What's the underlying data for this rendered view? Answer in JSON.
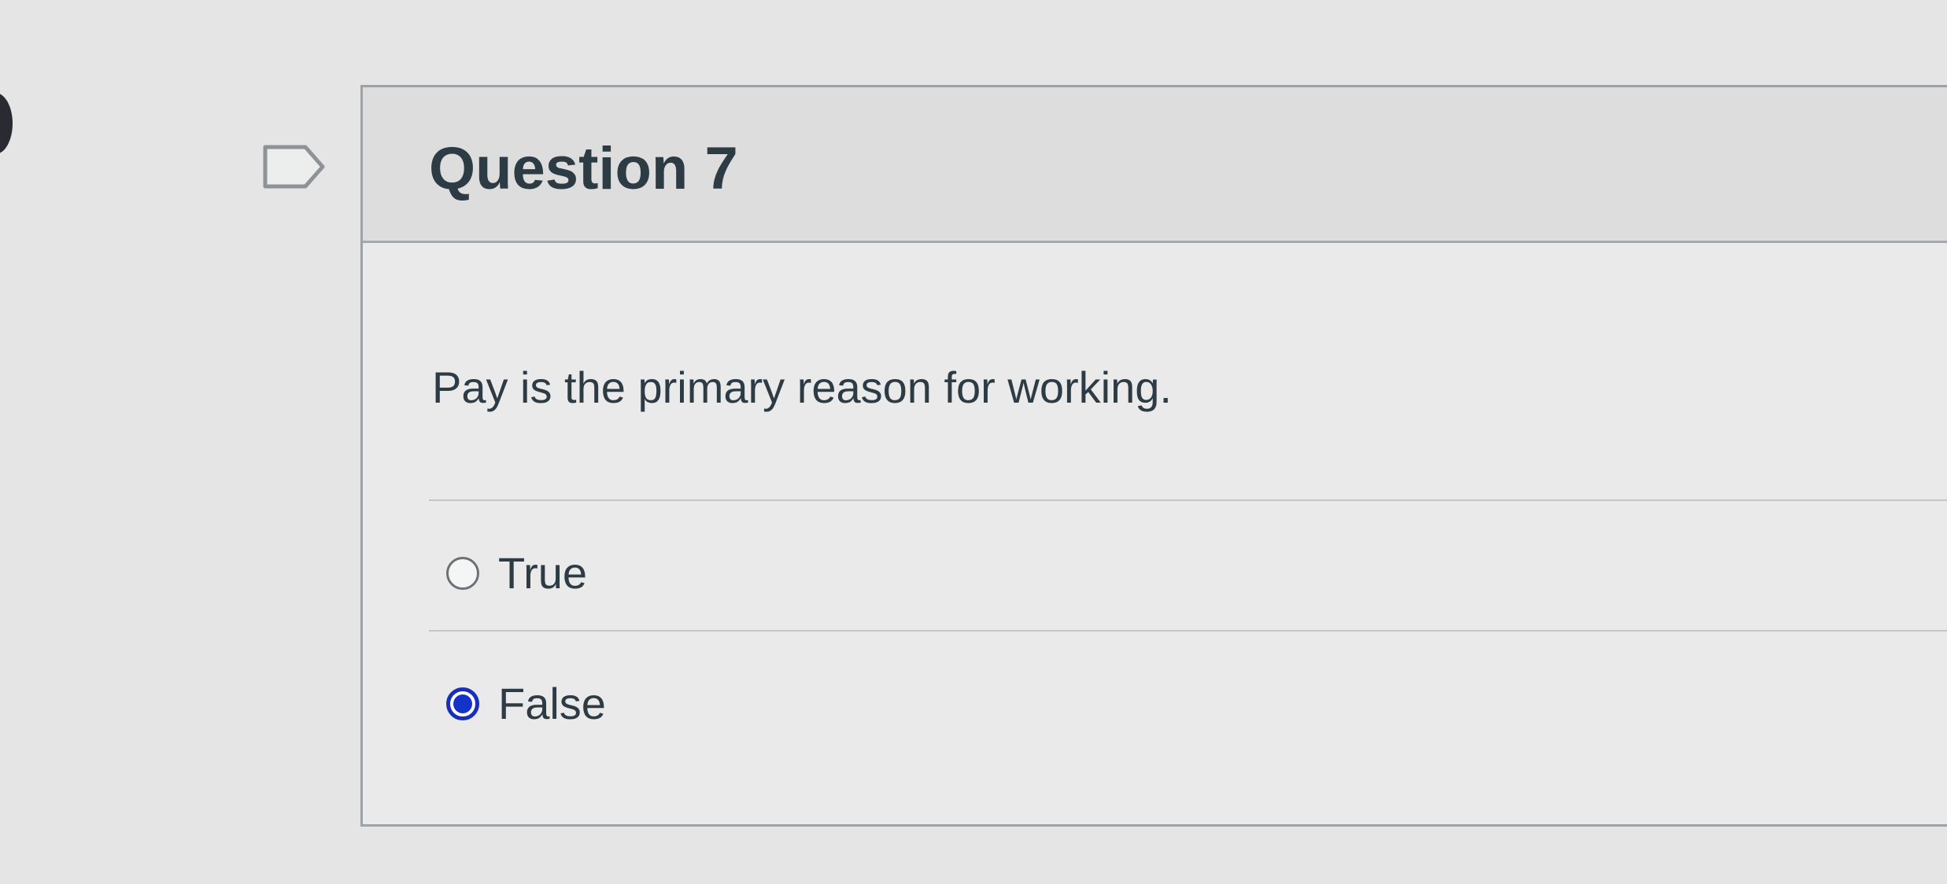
{
  "question": {
    "title": "Question 7",
    "prompt": "Pay is the primary reason for working.",
    "flagged": false,
    "answers": [
      {
        "label": "True",
        "selected": false
      },
      {
        "label": "False",
        "selected": true
      }
    ]
  },
  "colors": {
    "text": "#2d3b45",
    "selected_radio": "#1433c8",
    "border": "#9ea2a4"
  }
}
